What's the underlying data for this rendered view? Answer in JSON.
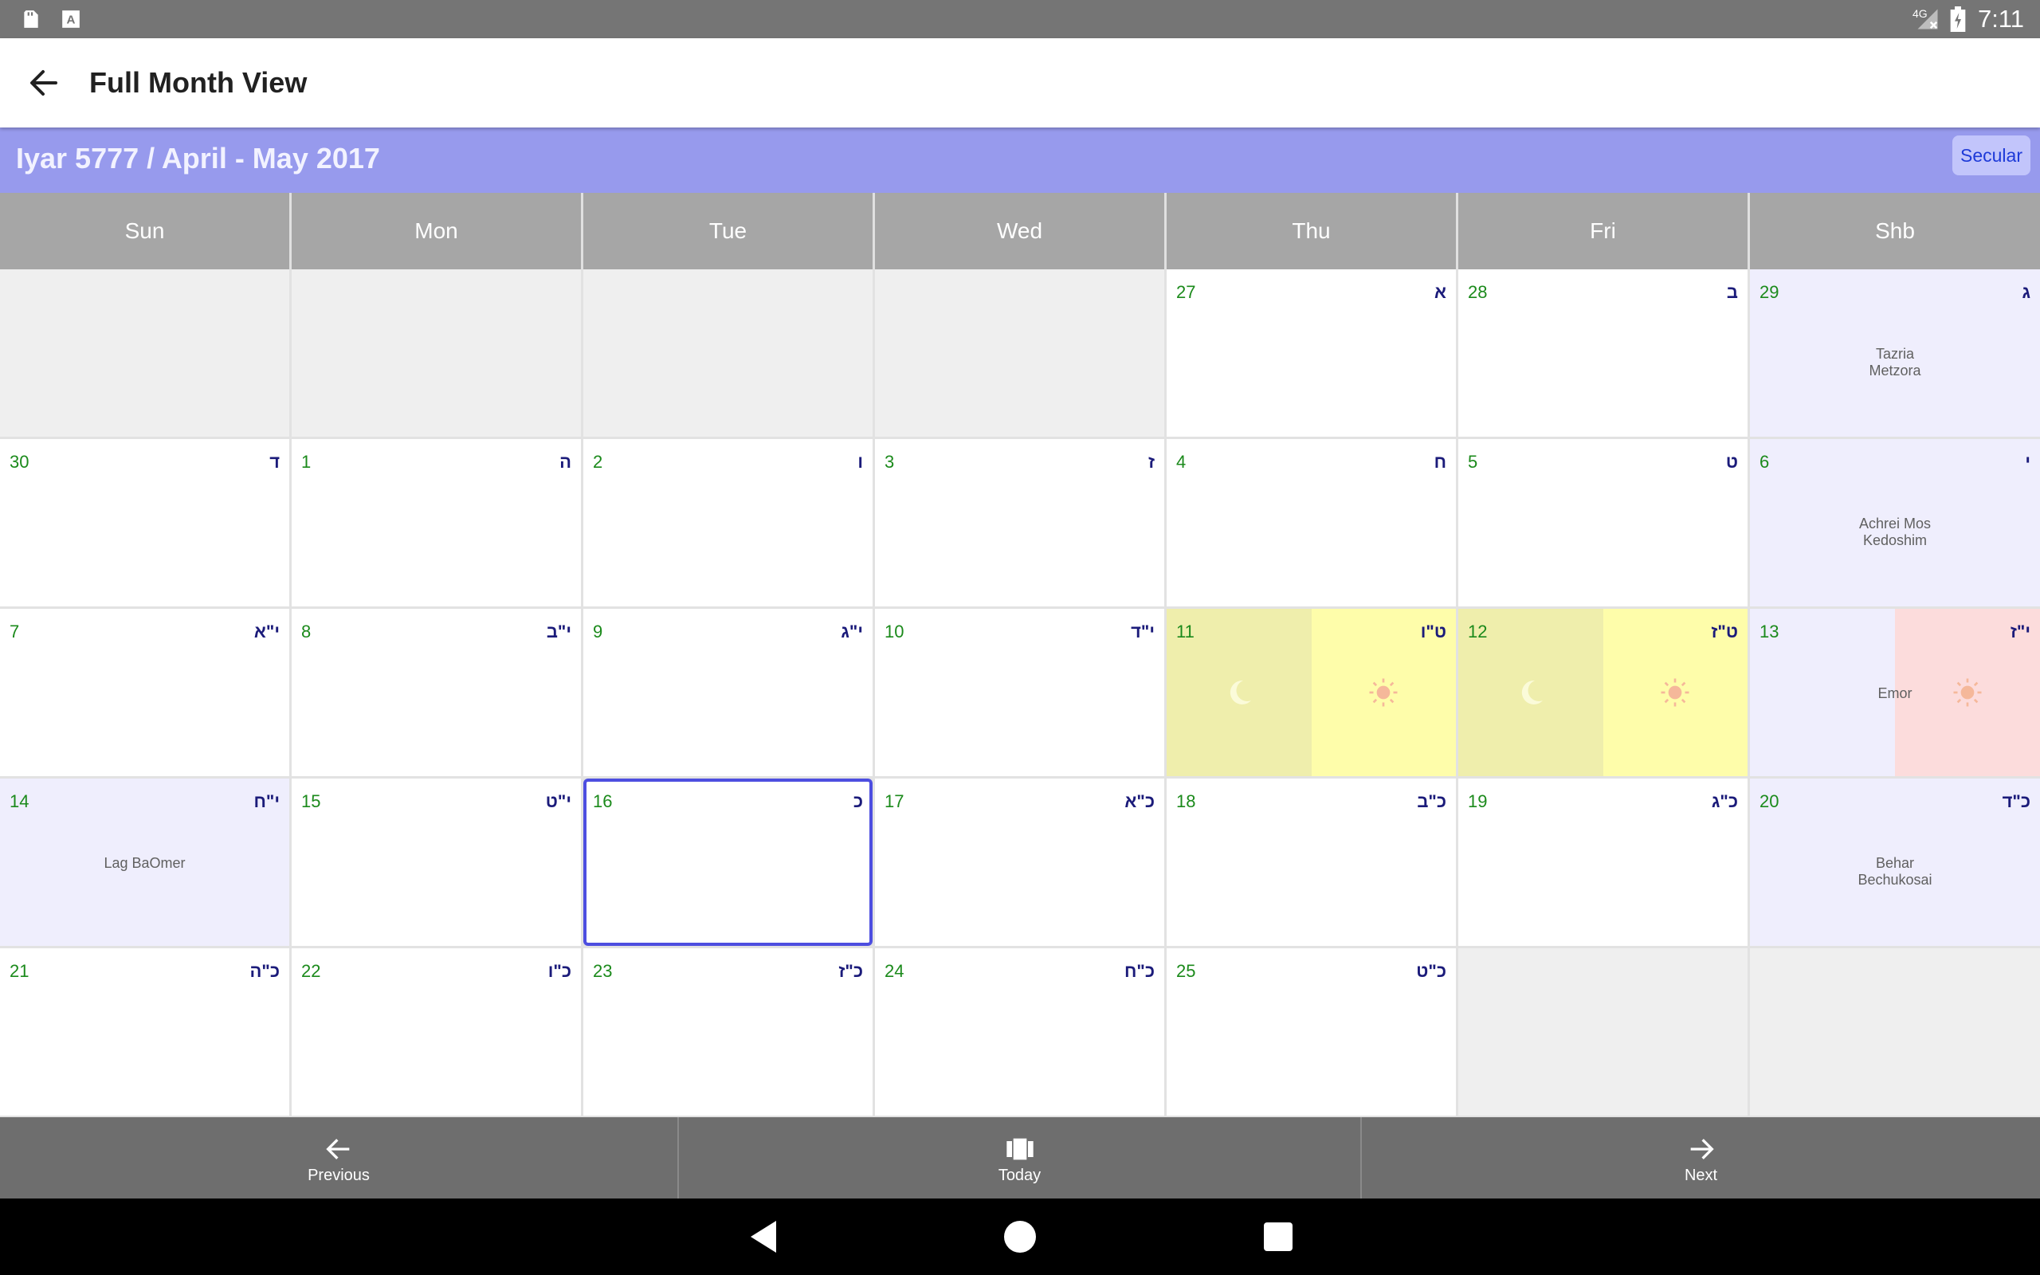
{
  "status_bar": {
    "time": "7:11",
    "network": "4G",
    "icons": [
      "sd-card-icon",
      "text-a-icon",
      "signal-icon",
      "battery-charging-icon"
    ]
  },
  "app_bar": {
    "title": "Full Month View",
    "back_icon": "arrow-left-icon"
  },
  "month_header": {
    "title": "Iyar 5777 / April - May 2017",
    "toggle_label": "Secular"
  },
  "weekdays": [
    "Sun",
    "Mon",
    "Tue",
    "Wed",
    "Thu",
    "Fri",
    "Shb"
  ],
  "weeks": [
    [
      {
        "empty": true
      },
      {
        "empty": true
      },
      {
        "empty": true
      },
      {
        "empty": true
      },
      {
        "day": "27",
        "heb": "א"
      },
      {
        "day": "28",
        "heb": "ב"
      },
      {
        "day": "29",
        "heb": "ג",
        "event_lines": [
          "Tazria",
          "Metzora"
        ],
        "shabbos": true
      }
    ],
    [
      {
        "day": "30",
        "heb": "ד"
      },
      {
        "day": "1",
        "heb": "ה"
      },
      {
        "day": "2",
        "heb": "ו"
      },
      {
        "day": "3",
        "heb": "ז"
      },
      {
        "day": "4",
        "heb": "ח"
      },
      {
        "day": "5",
        "heb": "ט"
      },
      {
        "day": "6",
        "heb": "י",
        "event_lines": [
          "Achrei Mos",
          "Kedoshim"
        ],
        "shabbos": true
      }
    ],
    [
      {
        "day": "7",
        "heb": "י\"א"
      },
      {
        "day": "8",
        "heb": "י\"ב"
      },
      {
        "day": "9",
        "heb": "י\"ג"
      },
      {
        "day": "10",
        "heb": "י\"ד"
      },
      {
        "day": "11",
        "heb": "ט\"ו",
        "split": "yellow"
      },
      {
        "day": "12",
        "heb": "ט\"ז",
        "split": "yellow"
      },
      {
        "day": "13",
        "heb": "י\"ז",
        "event_lines": [
          "Emor"
        ],
        "shabbos": true,
        "split": "pink"
      }
    ],
    [
      {
        "day": "14",
        "heb": "י\"ח",
        "event_lines": [
          "Lag BaOmer"
        ],
        "shabbos": true
      },
      {
        "day": "15",
        "heb": "י\"ט"
      },
      {
        "day": "16",
        "heb": "כ",
        "today": true
      },
      {
        "day": "17",
        "heb": "כ\"א"
      },
      {
        "day": "18",
        "heb": "כ\"ב"
      },
      {
        "day": "19",
        "heb": "כ\"ג"
      },
      {
        "day": "20",
        "heb": "כ\"ד",
        "event_lines": [
          "Behar",
          "Bechukosai"
        ],
        "shabbos": true
      }
    ],
    [
      {
        "day": "21",
        "heb": "כ\"ה"
      },
      {
        "day": "22",
        "heb": "כ\"ו"
      },
      {
        "day": "23",
        "heb": "כ\"ז"
      },
      {
        "day": "24",
        "heb": "כ\"ח"
      },
      {
        "day": "25",
        "heb": "כ\"ט"
      },
      {
        "empty": true
      },
      {
        "empty": true
      }
    ]
  ],
  "bottom_nav": {
    "previous": "Previous",
    "today": "Today",
    "next": "Next"
  },
  "colors": {
    "month_bar": "#979aed",
    "day_number": "#1b8a1b",
    "hebrew_date": "#1b1b7a",
    "today_border": "#4d4ee0",
    "shabbos_bg": "#efeefd"
  }
}
